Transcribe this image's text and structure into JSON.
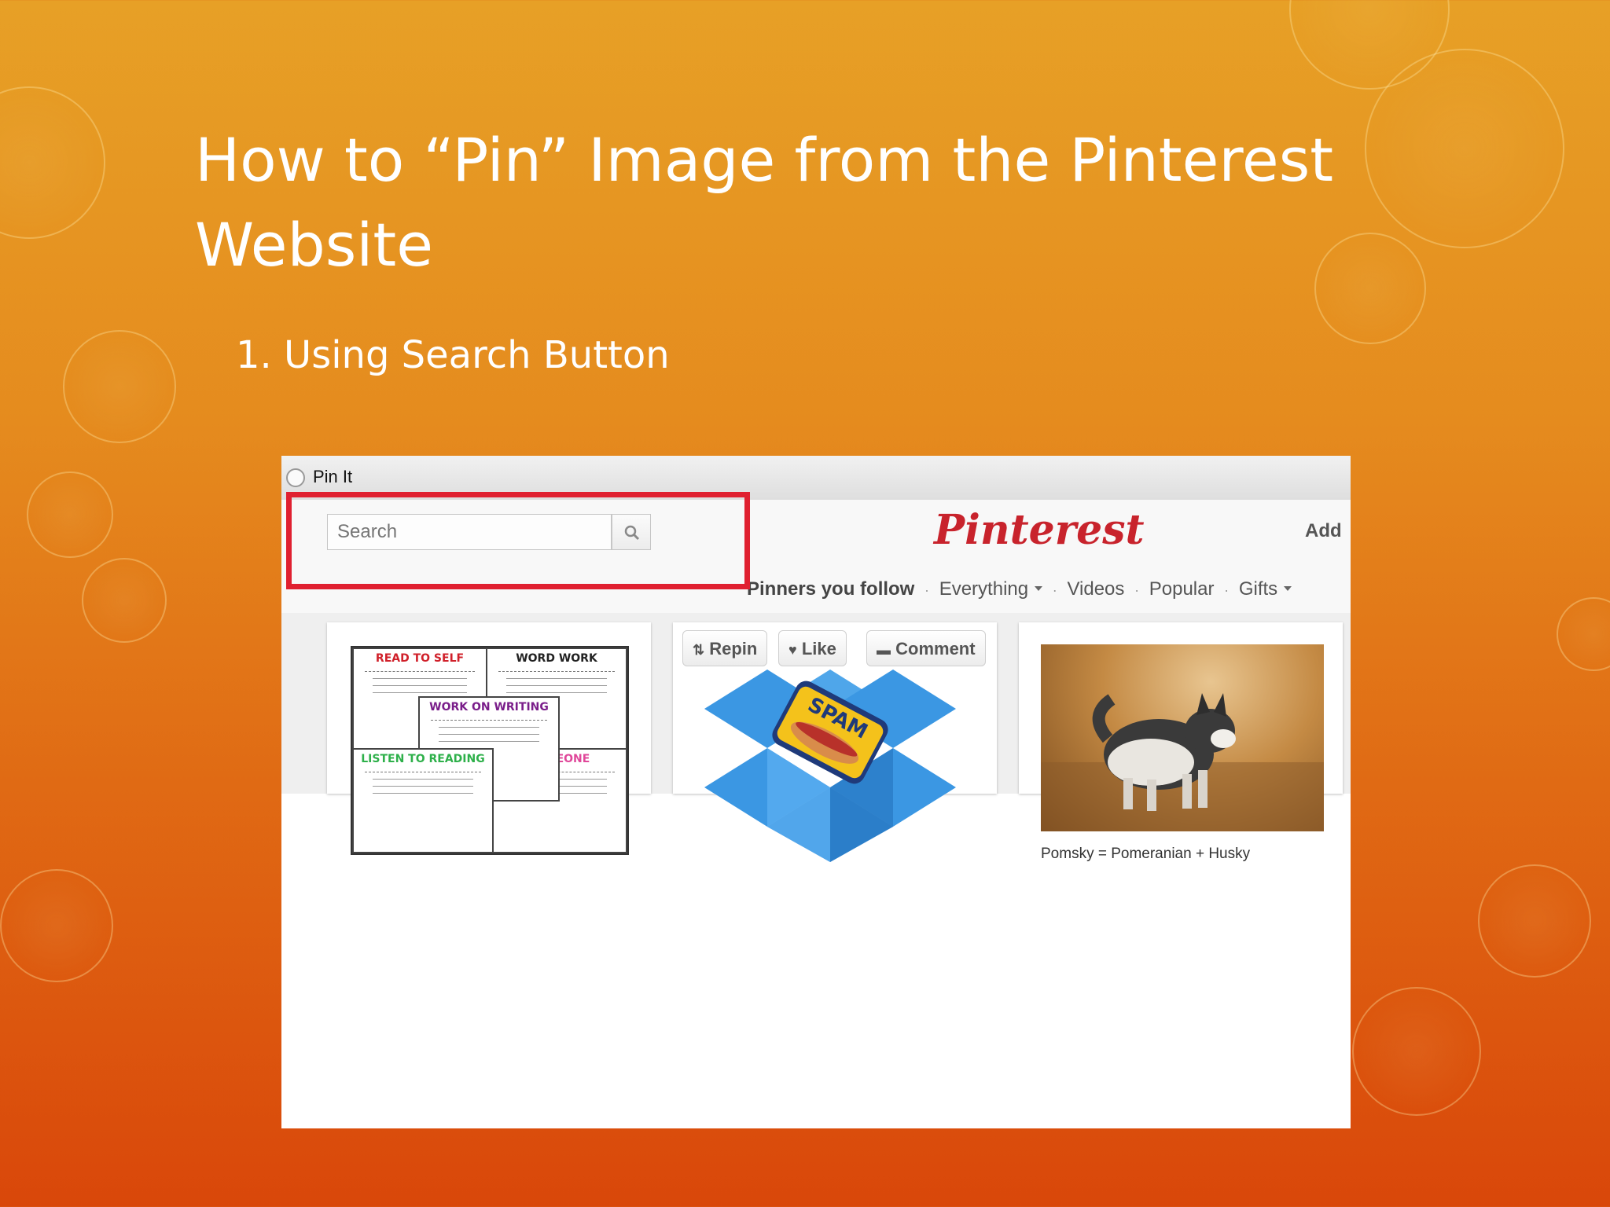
{
  "slide": {
    "title": "How to “Pin” Image from the Pinterest Website",
    "subtitle": "1. Using Search Button"
  },
  "window": {
    "title": "Pin It"
  },
  "header": {
    "search_placeholder": "Search",
    "logo": "Pinterest",
    "add_label": "Add"
  },
  "nav": {
    "items": [
      "Pinners you follow",
      "Everything",
      "Videos",
      "Popular",
      "Gifts"
    ]
  },
  "pins": {
    "poster_cards": [
      "READ TO SELF",
      "WORD WORK",
      "WORK ON WRITING",
      "LISTEN TO READING",
      "SOMEONE"
    ],
    "actions": [
      "Repin",
      "Like",
      "Comment"
    ],
    "can_label": "SPAM",
    "dog_caption": "Pomsky = Pomeranian + Husky"
  },
  "colors": {
    "highlight": "#e02030",
    "brand": "#c8232c"
  }
}
